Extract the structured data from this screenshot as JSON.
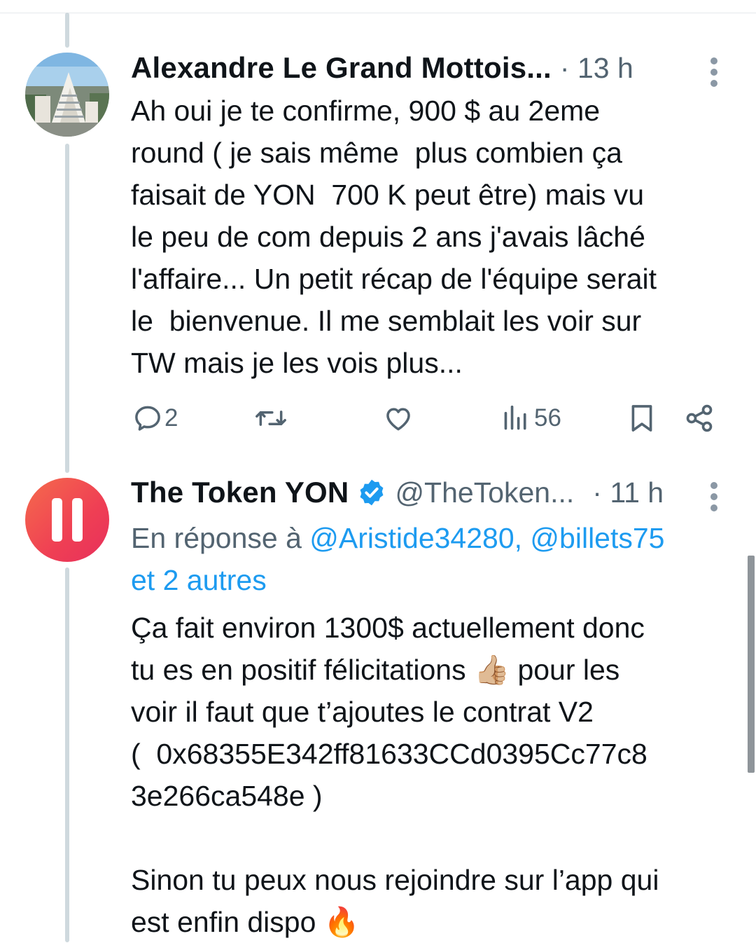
{
  "tweet1": {
    "author_name": "Alexandre Le Grand Mottois...",
    "time": "· 13 h",
    "text": "Ah oui je te confirme, 900 $ au 2eme\nround ( je sais même  plus combien ça\nfaisait de YON  700 K peut être) mais vu\nle peu de com depuis 2 ans j'avais lâché\nl'affaire... Un petit récap de l'équipe serait\nle  bienvenue. Il me semblait les voir sur\nTW mais je les vois plus...",
    "actions": {
      "reply_count": "2",
      "views_count": "56"
    }
  },
  "tweet2": {
    "author_name": "The Token YON",
    "handle": "@TheToken...",
    "time": "· 11 h",
    "reply_prefix": "En réponse à ",
    "reply_mentions": "@Aristide34280, @billets75",
    "reply_more": "et 2 autres",
    "text_part1": "Ça fait environ 1300$ actuellement donc\ntu es en positif félicitations ",
    "emoji_thumbs": "👍🏼",
    "text_part2": " pour les\nvoir il faut que t’ajoutes le contrat V2\n(  0x68355E342ff81633CCd0395Cc77c8\n3e266ca548e )\n\nSinon tu peux nous rejoindre sur l’app qui\nest enfin dispo ",
    "emoji_fire": "🔥"
  },
  "colors": {
    "text": "#0f1419",
    "secondary": "#536471",
    "link": "#1d9bf0",
    "verified": "#1d9bf0",
    "thread_line": "#cfd9de"
  },
  "icons": {
    "reply": "reply-icon",
    "retweet": "retweet-icon",
    "like": "heart-icon",
    "views": "views-icon",
    "bookmark": "bookmark-icon",
    "share": "share-icon",
    "more": "more-vertical-icon",
    "verified": "verified-badge-icon"
  }
}
